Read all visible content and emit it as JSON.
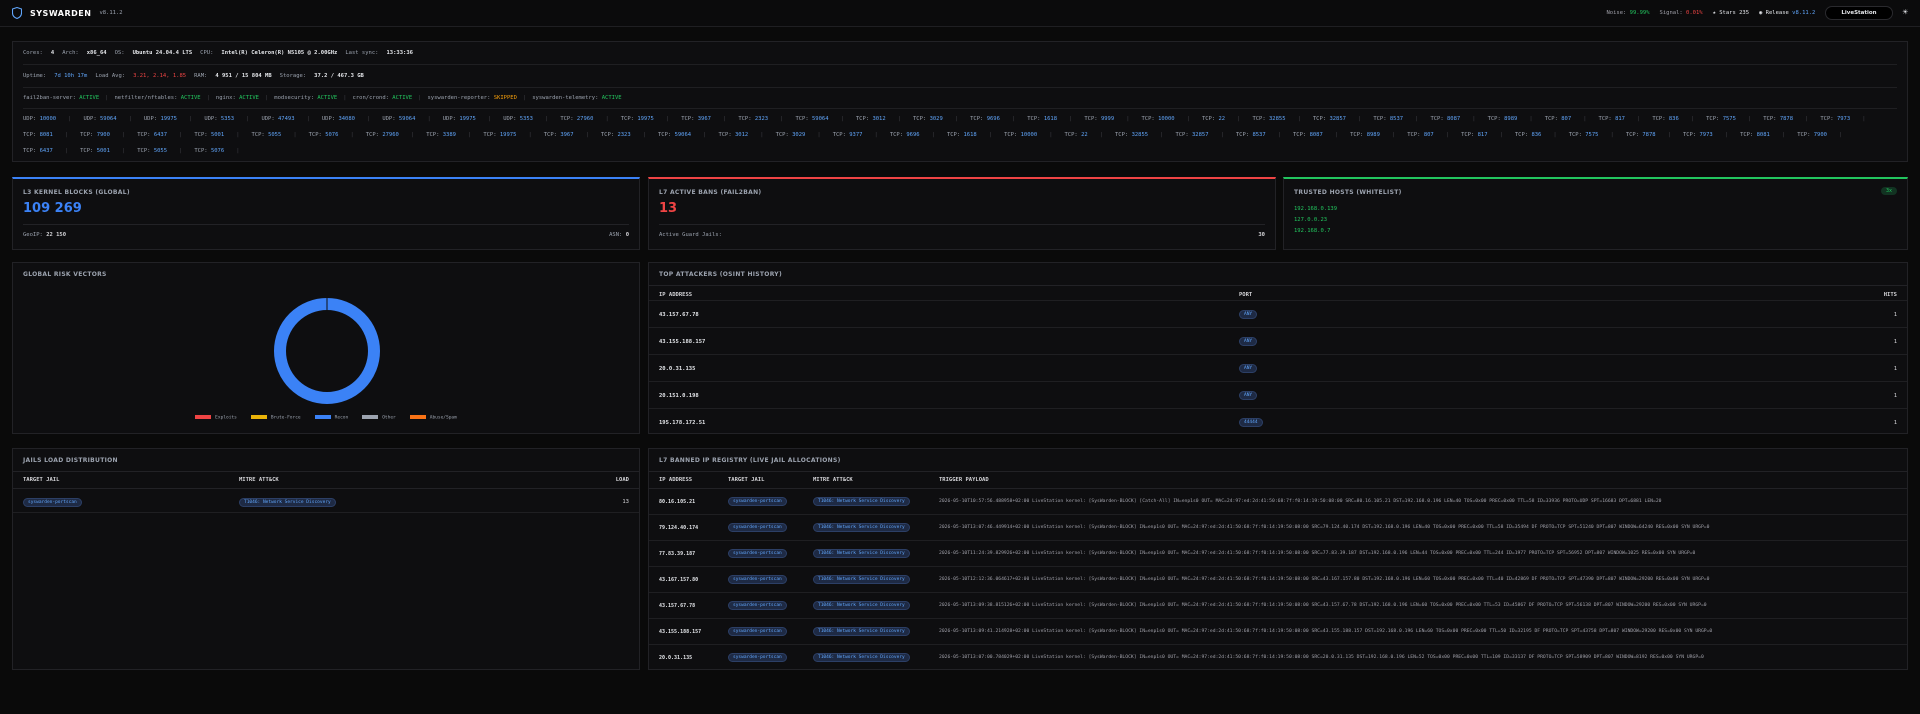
{
  "header": {
    "app_name": "SYSWARDEN",
    "version": "v8.11.2",
    "noise_label": "Noise:",
    "noise_value": "99.99%",
    "signal_label": "Signal:",
    "signal_value": "0.01%",
    "stars_label": "Stars",
    "stars_value": "235",
    "release_label": "Release",
    "release_value": "v8.11.2",
    "live_button": "LiveStation"
  },
  "system": {
    "cores_label": "Cores:",
    "cores": "4",
    "arch_label": "Arch:",
    "arch": "x86_64",
    "os_label": "OS:",
    "os": "Ubuntu 24.04.4 LTS",
    "cpu_label": "CPU:",
    "cpu": "Intel(R) Celeron(R) N5105 @ 2.00GHz",
    "sync_label": "Last sync:",
    "sync": "13:33:36",
    "uptime_label": "Uptime:",
    "uptime": "7d 10h 17m",
    "load_label": "Load Avg:",
    "load": "3.21, 2.14, 1.85",
    "ram_label": "RAM:",
    "ram": "4 951 / 15 804 MB",
    "storage_label": "Storage:",
    "storage": "37.2 / 467.3 GB"
  },
  "services": [
    {
      "name": "fail2ban-server:",
      "status": "ACTIVE",
      "state": "ok"
    },
    {
      "name": "netfilter/nftables:",
      "status": "ACTIVE",
      "state": "ok"
    },
    {
      "name": "nginx:",
      "status": "ACTIVE",
      "state": "ok"
    },
    {
      "name": "modsecurity:",
      "status": "ACTIVE",
      "state": "ok"
    },
    {
      "name": "cron/crond:",
      "status": "ACTIVE",
      "state": "ok"
    },
    {
      "name": "syswarden-reporter:",
      "status": "SKIPPED",
      "state": "warn"
    },
    {
      "name": "syswarden-telemetry:",
      "status": "ACTIVE",
      "state": "ok"
    }
  ],
  "ports": [
    {
      "proto": "UDP:",
      "port": "10000"
    },
    {
      "proto": "UDP:",
      "port": "59064"
    },
    {
      "proto": "UDP:",
      "port": "19975"
    },
    {
      "proto": "UDP:",
      "port": "5353"
    },
    {
      "proto": "UDP:",
      "port": "47493"
    },
    {
      "proto": "UDP:",
      "port": "34080"
    },
    {
      "proto": "UDP:",
      "port": "59064"
    },
    {
      "proto": "UDP:",
      "port": "19975"
    },
    {
      "proto": "UDP:",
      "port": "5353"
    },
    {
      "proto": "TCP:",
      "port": "27960"
    },
    {
      "proto": "TCP:",
      "port": "19975"
    },
    {
      "proto": "TCP:",
      "port": "3967"
    },
    {
      "proto": "TCP:",
      "port": "2323"
    },
    {
      "proto": "TCP:",
      "port": "59064"
    },
    {
      "proto": "TCP:",
      "port": "3012"
    },
    {
      "proto": "TCP:",
      "port": "3029"
    },
    {
      "proto": "TCP:",
      "port": "9696"
    },
    {
      "proto": "TCP:",
      "port": "1618"
    },
    {
      "proto": "TCP:",
      "port": "9999"
    },
    {
      "proto": "TCP:",
      "port": "10000"
    },
    {
      "proto": "TCP:",
      "port": "22"
    },
    {
      "proto": "TCP:",
      "port": "32855"
    },
    {
      "proto": "TCP:",
      "port": "32857"
    },
    {
      "proto": "TCP:",
      "port": "8537"
    },
    {
      "proto": "TCP:",
      "port": "8087"
    },
    {
      "proto": "TCP:",
      "port": "8989"
    },
    {
      "proto": "TCP:",
      "port": "807"
    },
    {
      "proto": "TCP:",
      "port": "817"
    },
    {
      "proto": "TCP:",
      "port": "836"
    },
    {
      "proto": "TCP:",
      "port": "7575"
    },
    {
      "proto": "TCP:",
      "port": "7878"
    },
    {
      "proto": "TCP:",
      "port": "7973"
    },
    {
      "proto": "TCP:",
      "port": "8081"
    },
    {
      "proto": "TCP:",
      "port": "7900"
    },
    {
      "proto": "TCP:",
      "port": "6437"
    },
    {
      "proto": "TCP:",
      "port": "5001"
    },
    {
      "proto": "TCP:",
      "port": "5055"
    },
    {
      "proto": "TCP:",
      "port": "5076"
    },
    {
      "proto": "TCP:",
      "port": "27960"
    },
    {
      "proto": "TCP:",
      "port": "3389"
    },
    {
      "proto": "TCP:",
      "port": "19975"
    },
    {
      "proto": "TCP:",
      "port": "3967"
    },
    {
      "proto": "TCP:",
      "port": "2323"
    },
    {
      "proto": "TCP:",
      "port": "59064"
    },
    {
      "proto": "TCP:",
      "port": "3012"
    },
    {
      "proto": "TCP:",
      "port": "3029"
    },
    {
      "proto": "TCP:",
      "port": "9377"
    },
    {
      "proto": "TCP:",
      "port": "9696"
    },
    {
      "proto": "TCP:",
      "port": "1618"
    },
    {
      "proto": "TCP:",
      "port": "10000"
    },
    {
      "proto": "TCP:",
      "port": "22"
    },
    {
      "proto": "TCP:",
      "port": "32855"
    },
    {
      "proto": "TCP:",
      "port": "32857"
    },
    {
      "proto": "TCP:",
      "port": "8537"
    },
    {
      "proto": "TCP:",
      "port": "8087"
    },
    {
      "proto": "TCP:",
      "port": "8989"
    },
    {
      "proto": "TCP:",
      "port": "807"
    },
    {
      "proto": "TCP:",
      "port": "817"
    },
    {
      "proto": "TCP:",
      "port": "836"
    },
    {
      "proto": "TCP:",
      "port": "7575"
    },
    {
      "proto": "TCP:",
      "port": "7878"
    },
    {
      "proto": "TCP:",
      "port": "7973"
    },
    {
      "proto": "TCP:",
      "port": "8081"
    },
    {
      "proto": "TCP:",
      "port": "7900"
    },
    {
      "proto": "TCP:",
      "port": "6437"
    },
    {
      "proto": "TCP:",
      "port": "5001"
    },
    {
      "proto": "TCP:",
      "port": "5055"
    },
    {
      "proto": "TCP:",
      "port": "5076"
    }
  ],
  "kernel": {
    "title": "L3 KERNEL BLOCKS (GLOBAL)",
    "value": "109 269",
    "geoip_label": "GeoIP:",
    "geoip": "22 150",
    "asn_label": "ASN:",
    "asn": "0"
  },
  "bans": {
    "title": "L7 ACTIVE BANS (FAIL2BAN)",
    "value": "13",
    "jails_label": "Active Guard Jails:",
    "jails": "30"
  },
  "trusted": {
    "title": "TRUSTED HOSTS (WHITELIST)",
    "badge": "3x",
    "hosts": [
      "192.168.0.139",
      "127.0.0.23",
      "192.168.0.7"
    ]
  },
  "risk": {
    "title": "GLOBAL RISK VECTORS",
    "legend": [
      {
        "label": "Exploits",
        "color": "#ef4444"
      },
      {
        "label": "Brute-Force",
        "color": "#eab308"
      },
      {
        "label": "Recon",
        "color": "#3b82f6"
      },
      {
        "label": "Other",
        "color": "#9ca3af"
      },
      {
        "label": "Abuse/Spam",
        "color": "#f97316"
      }
    ]
  },
  "chart_data": {
    "type": "pie",
    "title": "GLOBAL RISK VECTORS",
    "categories": [
      "Exploits",
      "Brute-Force",
      "Recon",
      "Other",
      "Abuse/Spam"
    ],
    "values": [
      0,
      0,
      100,
      0,
      0
    ]
  },
  "attackers": {
    "title": "TOP ATTACKERS (OSINT HISTORY)",
    "cols": [
      "IP ADDRESS",
      "PORT",
      "HITS"
    ],
    "rows": [
      {
        "ip": "43.157.67.78",
        "port": "ANY",
        "hits": "1"
      },
      {
        "ip": "43.155.188.157",
        "port": "ANY",
        "hits": "1"
      },
      {
        "ip": "20.0.31.135",
        "port": "ANY",
        "hits": "1"
      },
      {
        "ip": "20.151.0.198",
        "port": "ANY",
        "hits": "1"
      },
      {
        "ip": "195.178.172.51",
        "port": "44444",
        "hits": "1"
      }
    ]
  },
  "jails": {
    "title": "JAILS LOAD DISTRIBUTION",
    "cols": [
      "TARGET JAIL",
      "MITRE ATT&CK",
      "LOAD"
    ],
    "rows": [
      {
        "jail": "syswarden-portscan",
        "mitre": "T1046: Network Service Discovery",
        "load": "13"
      }
    ]
  },
  "registry": {
    "title": "L7 BANNED IP REGISTRY (LIVE JAIL ALLOCATIONS)",
    "cols": [
      "IP ADDRESS",
      "TARGET JAIL",
      "MITRE ATT&CK",
      "TRIGGER PAYLOAD"
    ],
    "rows": [
      {
        "ip": "80.16.105.21",
        "jail": "syswarden-portscan",
        "mitre": "T1046: Network Service Discovery",
        "payload": "2026-05-10T10:57:56.488958+02:00 LiveStation kernel: [SysWarden-BLOCK] [Catch-All] IN=enp1s0 OUT= MAC=24:97:ed:2d:41:50:68:7f:f0:14:19:50:08:00 SRC=80.16.105.21 DST=192.168.0.196 LEN=40 TOS=0x00 PREC=0x00 TTL=58 ID=33936 PROTO=UDP SPT=16683 DPT=6881 LEN=20"
      },
      {
        "ip": "79.124.40.174",
        "jail": "syswarden-portscan",
        "mitre": "T1046: Network Service Discovery",
        "payload": "2026-05-10T13:07:46.449914+02:00 LiveStation kernel: [SysWarden-BLOCK] IN=enp1s0 OUT= MAC=24:97:ed:2d:41:50:68:7f:f0:14:19:50:08:00 SRC=79.124.40.174 DST=192.168.0.196 LEN=40 TOS=0x00 PREC=0x00 TTL=58 ID=35494 DF PROTO=TCP SPT=51240 DPT=807 WINDOW=64240 RES=0x00 SYN URGP=0"
      },
      {
        "ip": "77.83.39.187",
        "jail": "syswarden-portscan",
        "mitre": "T1046: Network Service Discovery",
        "payload": "2026-05-10T11:24:39.829926+02:00 LiveStation kernel: [SysWarden-BLOCK] IN=enp1s0 OUT= MAC=24:97:ed:2d:41:50:68:7f:f0:14:19:50:08:00 SRC=77.83.39.187 DST=192.168.0.196 LEN=44 TOS=0x00 PREC=0x00 TTL=244 ID=1977 PROTO=TCP SPT=56952 DPT=807 WINDOW=1025 RES=0x00 SYN URGP=0"
      },
      {
        "ip": "43.167.157.80",
        "jail": "syswarden-portscan",
        "mitre": "T1046: Network Service Discovery",
        "payload": "2026-05-10T12:12:36.064617+02:00 LiveStation kernel: [SysWarden-BLOCK] IN=enp1s0 OUT= MAC=24:97:ed:2d:41:50:68:7f:f0:14:19:50:08:00 SRC=43.167.157.80 DST=192.168.0.196 LEN=60 TOS=0x00 PREC=0x00 TTL=40 ID=42869 DF PROTO=TCP SPT=47390 DPT=807 WINDOW=29200 RES=0x00 SYN URGP=0"
      },
      {
        "ip": "43.157.67.78",
        "jail": "syswarden-portscan",
        "mitre": "T1046: Network Service Discovery",
        "payload": "2026-05-10T13:09:38.815126+02:00 LiveStation kernel: [SysWarden-BLOCK] IN=enp1s0 OUT= MAC=24:97:ed:2d:41:50:68:7f:f0:14:19:50:08:00 SRC=43.157.67.78 DST=192.168.0.196 LEN=60 TOS=0x00 PREC=0x00 TTL=53 ID=45867 DF PROTO=TCP SPT=56138 DPT=807 WINDOW=29200 RES=0x00 SYN URGP=0"
      },
      {
        "ip": "43.155.188.157",
        "jail": "syswarden-portscan",
        "mitre": "T1046: Network Service Discovery",
        "payload": "2026-05-10T13:09:41.214928+02:00 LiveStation kernel: [SysWarden-BLOCK] IN=enp1s0 OUT= MAC=24:97:ed:2d:41:50:68:7f:f0:14:19:50:08:00 SRC=43.155.188.157 DST=192.168.0.196 LEN=60 TOS=0x00 PREC=0x00 TTL=50 ID=32195 DF PROTO=TCP SPT=43758 DPT=807 WINDOW=29200 RES=0x00 SYN URGP=0"
      },
      {
        "ip": "20.0.31.135",
        "jail": "syswarden-portscan",
        "mitre": "T1046: Network Service Discovery",
        "payload": "2026-05-10T13:07:00.784029+02:00 LiveStation kernel: [SysWarden-BLOCK] IN=enp1s0 OUT= MAC=24:97:ed:2d:41:50:68:7f:f0:14:19:50:08:00 SRC=20.0.31.135 DST=192.168.0.196 LEN=52 TOS=0x00 PREC=0x00 TTL=109 ID=33137 DF PROTO=TCP SPT=58909 DPT=807 WINDOW=8192 RES=0x00 SYN URGP=0"
      }
    ]
  }
}
